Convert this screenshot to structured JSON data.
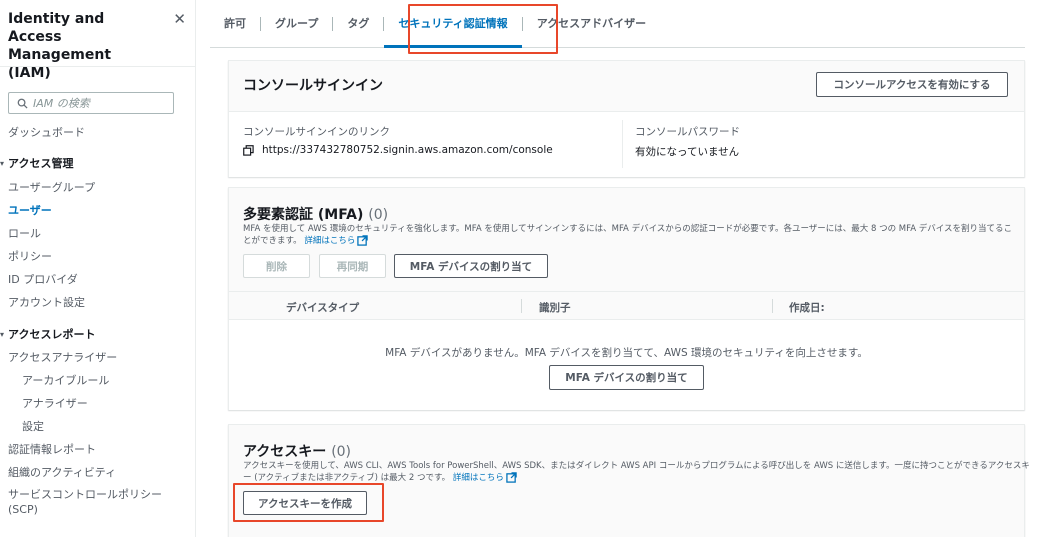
{
  "sidebar": {
    "title": "Identity and Access Management (IAM)",
    "close_icon": "close-icon",
    "search_placeholder": "IAM の検索",
    "dashboard": "ダッシュボード",
    "access_management": {
      "label": "アクセス管理",
      "items": [
        "ユーザーグループ",
        "ユーザー",
        "ロール",
        "ポリシー",
        "ID プロバイダ",
        "アカウント設定"
      ],
      "active": "ユーザー"
    },
    "access_reports": {
      "label": "アクセスレポート",
      "items": [
        "アクセスアナライザー",
        "アーカイブルール",
        "アナライザー",
        "設定",
        "認証情報レポート",
        "組織のアクティビティ",
        "サービスコントロールポリシー (SCP)"
      ]
    }
  },
  "tabs": [
    "許可",
    "グループ",
    "タグ",
    "セキュリティ認証情報",
    "アクセスアドバイザー"
  ],
  "active_tab": "セキュリティ認証情報",
  "console_signin": {
    "title": "コンソールサインイン",
    "enable_button": "コンソールアクセスを有効にする",
    "link_label": "コンソールサインインのリンク",
    "link_url": "https://337432780752.signin.aws.amazon.com/console",
    "password_label": "コンソールパスワード",
    "password_value": "有効になっていません"
  },
  "mfa": {
    "title": "多要素認証 (MFA)",
    "count": "(0)",
    "description": "MFA を使用して AWS 環境のセキュリティを強化します。MFA を使用してサインインするには、MFA デバイスからの認証コードが必要です。各ユーザーには、最大 8 つの MFA デバイスを割り当てることができます。",
    "learn_more": "詳細はこちら",
    "delete_button": "削除",
    "resync_button": "再同期",
    "assign_button": "MFA デバイスの割り当て",
    "columns": [
      "デバイスタイプ",
      "識別子",
      "作成日:"
    ],
    "empty_message": "MFA デバイスがありません。MFA デバイスを割り当てて、AWS 環境のセキュリティを向上させます。",
    "empty_assign_button": "MFA デバイスの割り当て"
  },
  "access_keys": {
    "title": "アクセスキー",
    "count": "(0)",
    "description": "アクセスキーを使用して、AWS CLI、AWS Tools for PowerShell、AWS SDK、またはダイレクト AWS API コールからプログラムによる呼び出しを AWS に送信します。一度に持つことができるアクセスキー (アクティブまたは非アクティブ) は最大 2 つです。",
    "learn_more": "詳細はこちら",
    "create_button": "アクセスキーを作成"
  },
  "colors": {
    "link": "#0073bb",
    "highlight": "#e8472a",
    "text": "#16191f",
    "muted": "#545b64"
  }
}
